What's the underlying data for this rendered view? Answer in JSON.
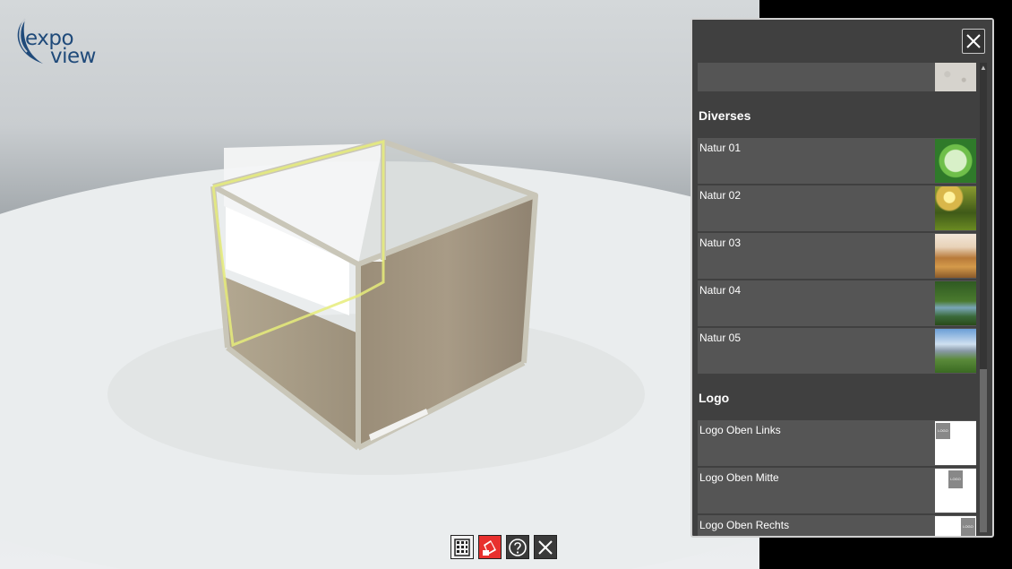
{
  "brand": {
    "logo_word1": "expo",
    "logo_word2": "view"
  },
  "panel": {
    "close_icon": "close-icon",
    "items": [
      {
        "type": "row",
        "label": "",
        "thumb": "concrete",
        "partial": true
      },
      {
        "type": "header",
        "label": "Diverses"
      },
      {
        "type": "row",
        "label": "Natur 01",
        "thumb": "globe-green"
      },
      {
        "type": "row",
        "label": "Natur 02",
        "thumb": "forest-sun"
      },
      {
        "type": "row",
        "label": "Natur 03",
        "thumb": "autumn-landscape"
      },
      {
        "type": "row",
        "label": "Natur 04",
        "thumb": "river-forest"
      },
      {
        "type": "row",
        "label": "Natur 05",
        "thumb": "mountain-sky"
      },
      {
        "type": "header",
        "label": "Logo"
      },
      {
        "type": "row",
        "label": "Logo Oben Links",
        "thumb": "logo-left",
        "logo_text": "LOGO"
      },
      {
        "type": "row",
        "label": "Logo Oben Mitte",
        "thumb": "logo-center",
        "logo_text": "LOGO"
      },
      {
        "type": "row",
        "label": "Logo Oben Rechts",
        "thumb": "logo-right",
        "logo_text": "LOGO"
      }
    ]
  },
  "toolbar": {
    "buttons": [
      {
        "name": "floor-plan-button",
        "icon": "building-grid-icon"
      },
      {
        "name": "material-button",
        "icon": "paint-swatch-icon",
        "active": true
      },
      {
        "name": "help-button",
        "icon": "help-icon"
      },
      {
        "name": "close-button",
        "icon": "close-icon"
      }
    ]
  },
  "colors": {
    "panel_bg": "#404040",
    "row_bg": "#555555",
    "accent": "#e8302e",
    "logo_blue": "#1f4a7a"
  }
}
